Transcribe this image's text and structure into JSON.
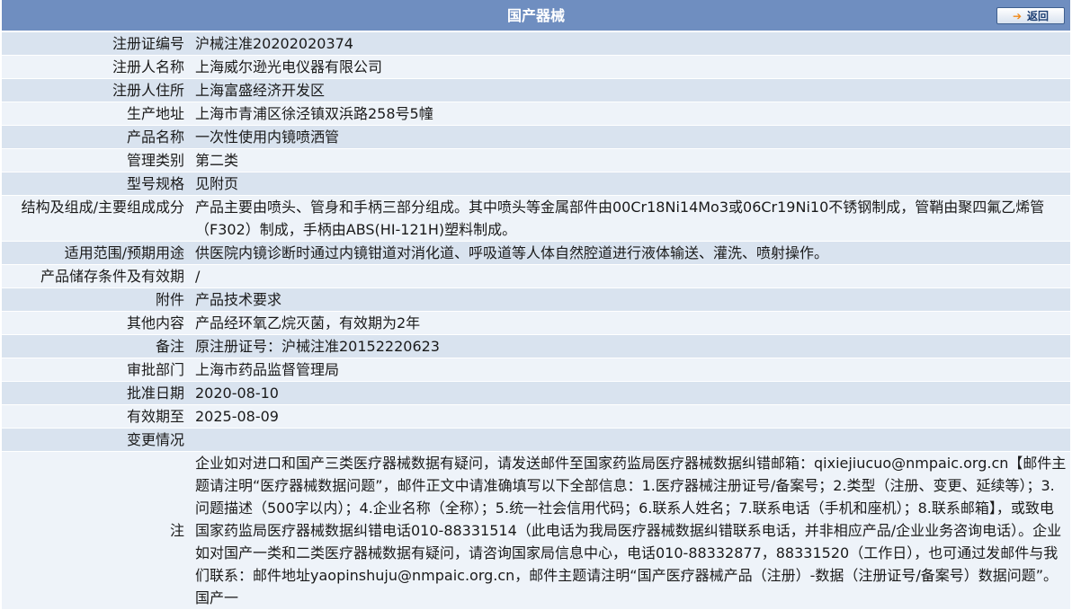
{
  "header": {
    "title": "国产器械",
    "back_label": "返回"
  },
  "rows": [
    {
      "label": "注册证编号",
      "value": "沪械注准20202020374"
    },
    {
      "label": "注册人名称",
      "value": "上海威尔逊光电仪器有限公司"
    },
    {
      "label": "注册人住所",
      "value": "上海富盛经济开发区"
    },
    {
      "label": "生产地址",
      "value": "上海市青浦区徐泾镇双浜路258号5幢"
    },
    {
      "label": "产品名称",
      "value": "一次性使用内镜喷洒管"
    },
    {
      "label": "管理类别",
      "value": "第二类"
    },
    {
      "label": "型号规格",
      "value": "见附页"
    },
    {
      "label": "结构及组成/主要组成成分",
      "value": "产品主要由喷头、管身和手柄三部分组成。其中喷头等金属部件由00Cr18Ni14Mo3或06Cr19Ni10不锈钢制成，管鞘由聚四氟乙烯管（F302）制成，手柄由ABS(HI-121H)塑料制成。"
    },
    {
      "label": "适用范围/预期用途",
      "value": "供医院内镜诊断时通过内镜钳道对消化道、呼吸道等人体自然腔道进行液体输送、灌洗、喷射操作。"
    },
    {
      "label": "产品储存条件及有效期",
      "value": "/"
    },
    {
      "label": "附件",
      "value": "产品技术要求"
    },
    {
      "label": "其他内容",
      "value": "产品经环氧乙烷灭菌，有效期为2年"
    },
    {
      "label": "备注",
      "value": "原注册证号：沪械注准20152220623"
    },
    {
      "label": "审批部门",
      "value": "上海市药品监督管理局"
    },
    {
      "label": "批准日期",
      "value": "2020-08-10"
    },
    {
      "label": "有效期至",
      "value": "2025-08-09"
    },
    {
      "label": "变更情况",
      "value": ""
    }
  ],
  "note": {
    "label": "注",
    "text": "企业如对进口和国产三类医疗器械数据有疑问，请发送邮件至国家药监局医疗器械数据纠错邮箱：qixiejiucuo@nmpaic.org.cn【邮件主题请注明“医疗器械数据问题”，邮件正文中请准确填写以下全部信息：1.医疗器械注册证号/备案号；2.类型（注册、变更、延续等）；3.问题描述（500字以内）；4.企业名称（全称）；5.统一社会信用代码；6.联系人姓名；7.联系电话（手机和座机）；8.联系邮箱】，或致电国家药监局医疗器械数据纠错电话010-88331514（此电话为我局医疗器械数据纠错联系电话，并非相应产品/企业业务咨询电话）。企业如对国产一类和二类医疗器械数据有疑问，请咨询国家局信息中心，电话010-88332877，88331520（工作日），也可通过发邮件与我们联系：邮件地址yaopinshuju@nmpaic.org.cn，邮件主题请注明“国产医疗器械产品（注册）-数据（注册证号/备案号）数据问题”。国产一"
  }
}
